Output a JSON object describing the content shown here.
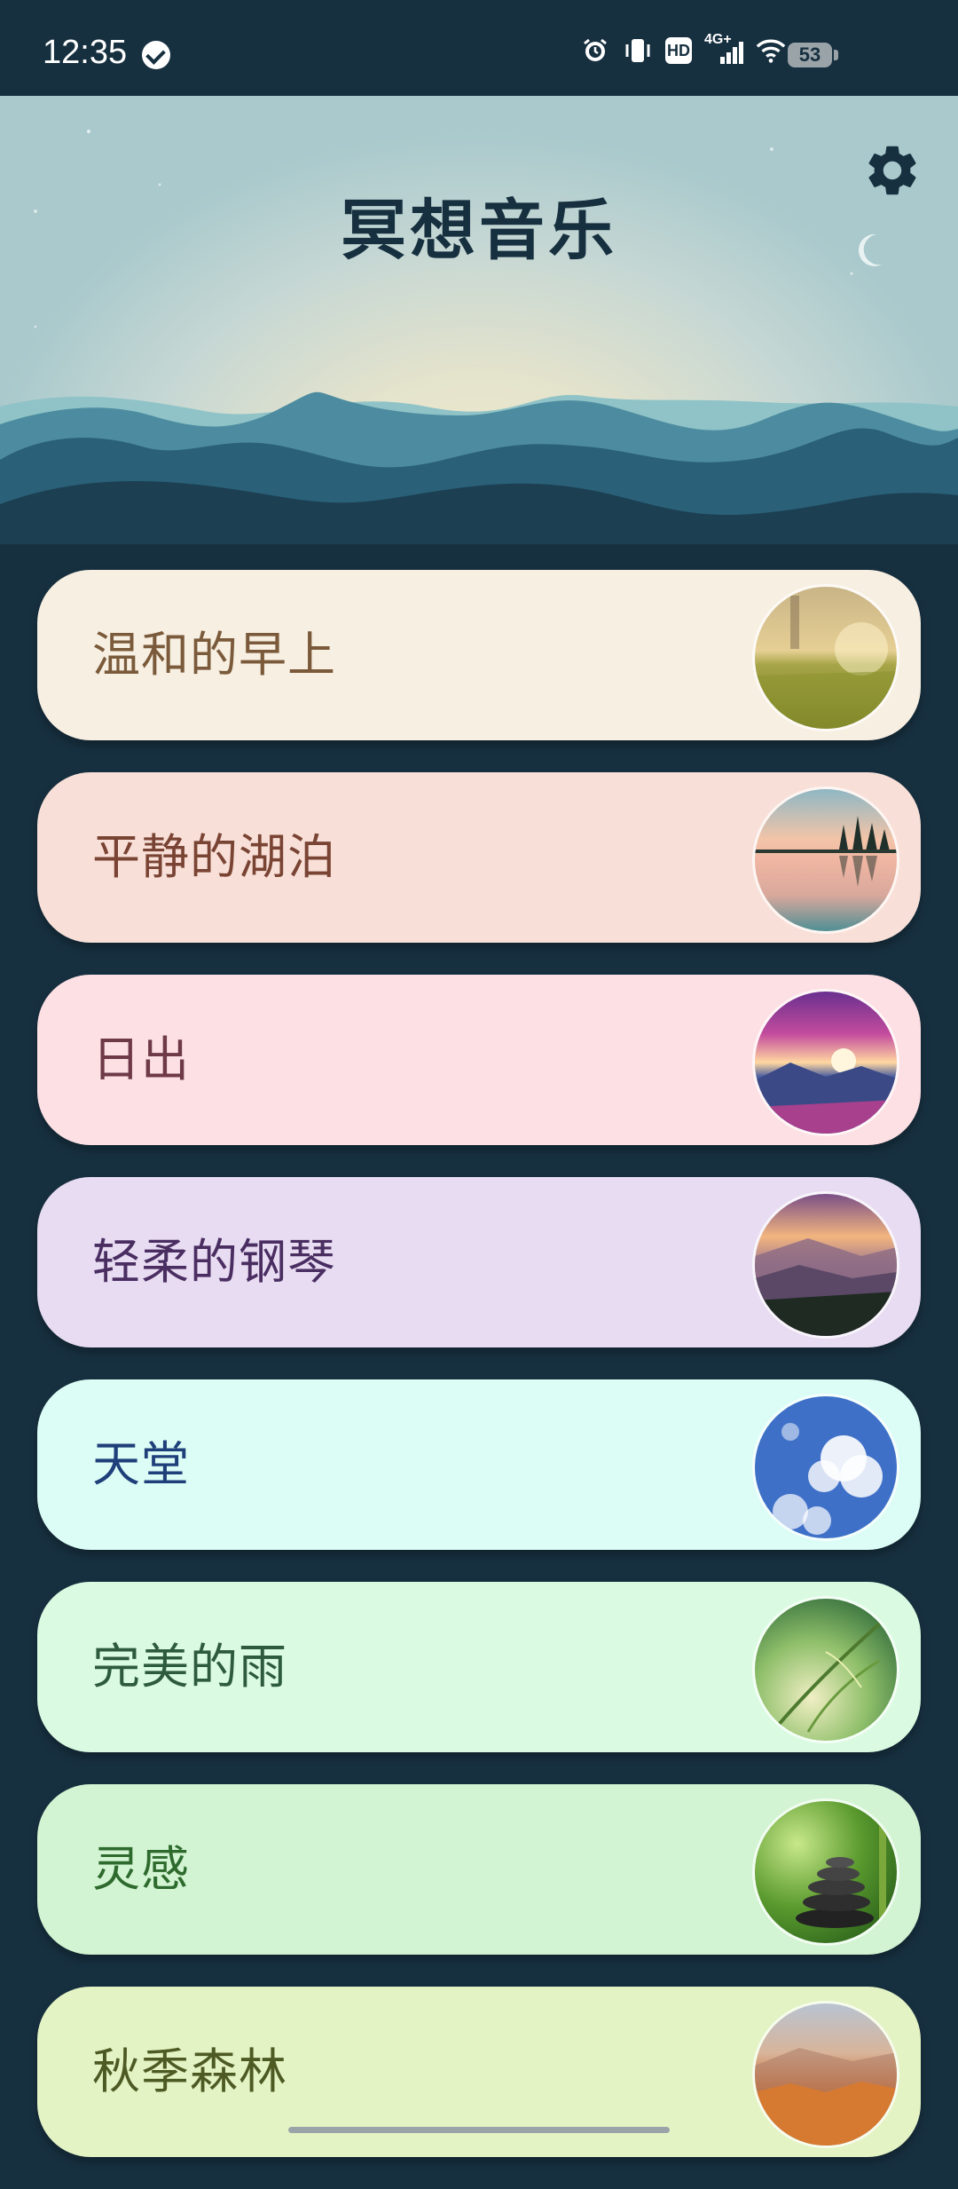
{
  "status_bar": {
    "time": "12:35",
    "network": "4G+",
    "hd": "HD",
    "battery": "53",
    "icons": [
      "verified-icon",
      "alarm-icon",
      "vibrate-icon",
      "hd-icon",
      "signal-icon",
      "wifi-icon",
      "battery-icon"
    ]
  },
  "header": {
    "title": "冥想音乐",
    "settings_icon": "gear-icon"
  },
  "tracks": [
    {
      "label": "温和的早上",
      "bg": "#f7efe2",
      "fg": "#7a5a3a",
      "image": "sunlit-meadow"
    },
    {
      "label": "平静的湖泊",
      "bg": "#f8e0d8",
      "fg": "#7a4434",
      "image": "calm-lake"
    },
    {
      "label": "日出",
      "bg": "#fde0e4",
      "fg": "#6e3a48",
      "image": "sunrise-mountains"
    },
    {
      "label": "轻柔的钢琴",
      "bg": "#e8dcf2",
      "fg": "#4a2e62",
      "image": "misty-mountain-forest"
    },
    {
      "label": "天堂",
      "bg": "#dcfdf6",
      "fg": "#1f3f7a",
      "image": "blue-sky-clouds"
    },
    {
      "label": "完美的雨",
      "bg": "#dafbe2",
      "fg": "#2e5a3e",
      "image": "green-grass"
    },
    {
      "label": "灵感",
      "bg": "#d2f4d2",
      "fg": "#2e6a2e",
      "image": "zen-stones"
    },
    {
      "label": "秋季森林",
      "bg": "#e3f3c4",
      "fg": "#4e5a24",
      "image": "autumn-forest"
    }
  ],
  "colors": {
    "background": "#173040",
    "accent": "#173040"
  }
}
